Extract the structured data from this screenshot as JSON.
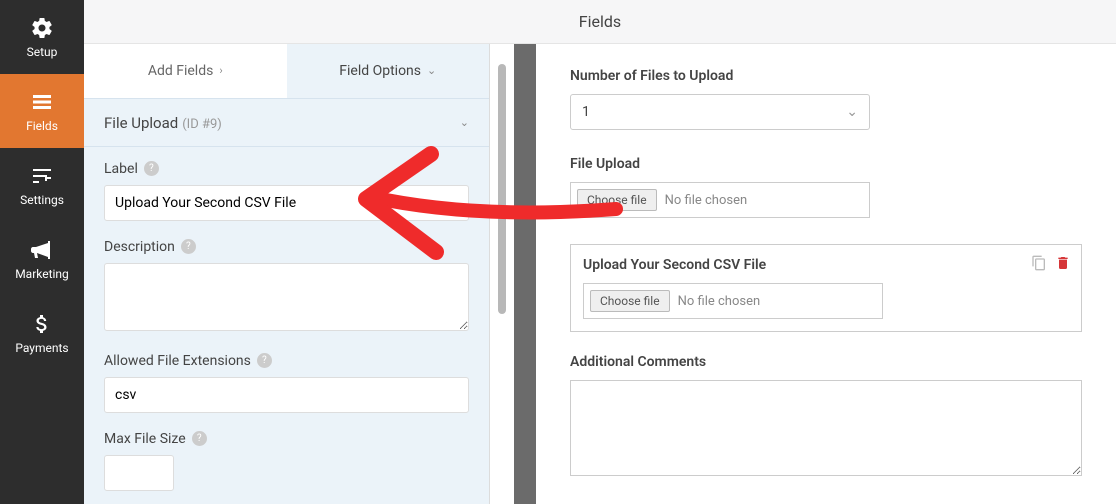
{
  "header": {
    "title": "Fields"
  },
  "sidebar": {
    "items": [
      {
        "label": "Setup"
      },
      {
        "label": "Fields"
      },
      {
        "label": "Settings"
      },
      {
        "label": "Marketing"
      },
      {
        "label": "Payments"
      }
    ]
  },
  "tabs": {
    "add": "Add Fields",
    "options": "Field Options"
  },
  "section": {
    "title": "File Upload",
    "id": "(ID #9)"
  },
  "panel": {
    "label_caption": "Label",
    "label_value": "Upload Your Second CSV File",
    "desc_caption": "Description",
    "ext_caption": "Allowed File Extensions",
    "ext_value": "csv",
    "size_caption": "Max File Size"
  },
  "preview": {
    "num_files_label": "Number of Files to Upload",
    "num_files_value": "1",
    "file_upload_label": "File Upload",
    "choose_btn": "Choose file",
    "no_file": "No file chosen",
    "second_label": "Upload Your Second CSV File",
    "comments_label": "Additional Comments"
  }
}
